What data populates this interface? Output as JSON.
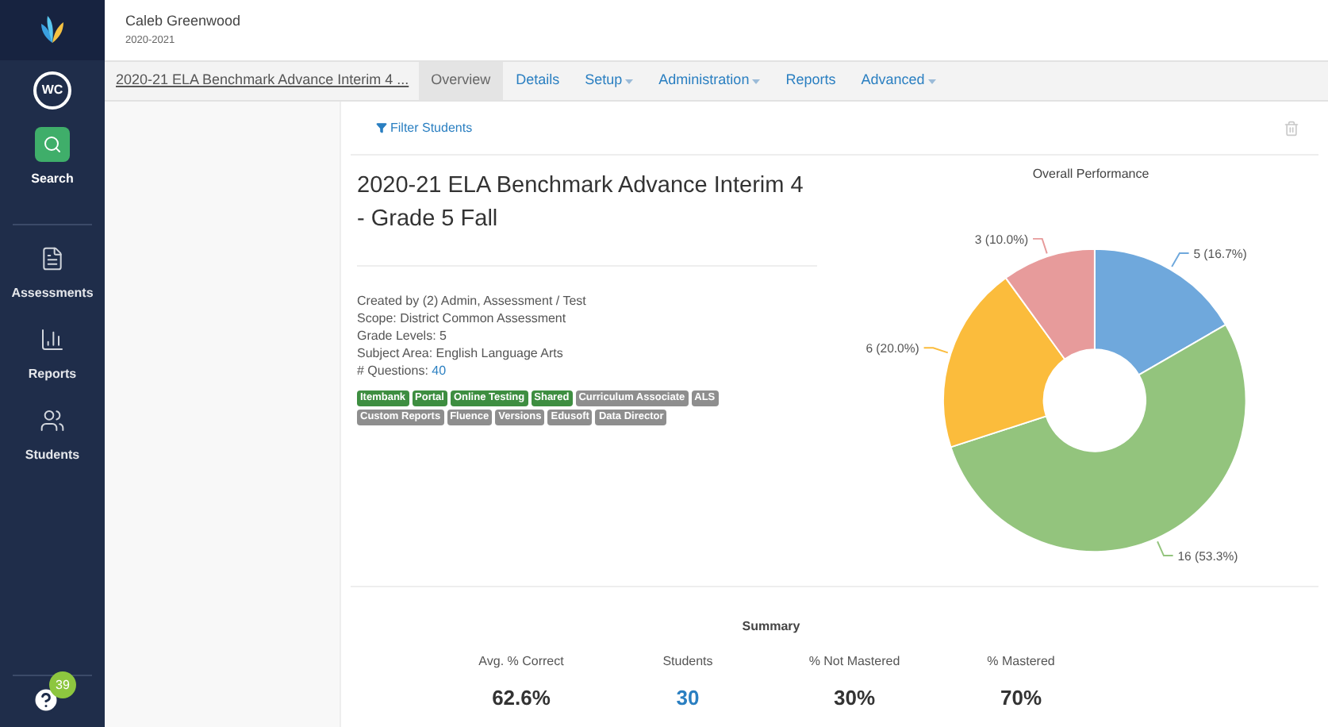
{
  "header": {
    "user_name": "Caleb Greenwood",
    "school_year": "2020-2021"
  },
  "sidebar": {
    "avatar": "WC",
    "items": [
      {
        "kind": "search",
        "label": "Search",
        "selected": true
      },
      {
        "kind": "assessments",
        "label": "Assessments",
        "selected": false
      },
      {
        "kind": "reports",
        "label": "Reports",
        "selected": false
      },
      {
        "kind": "students",
        "label": "Students",
        "selected": false
      }
    ],
    "help_badge": "39"
  },
  "tabs": [
    {
      "kind": "title",
      "label": "2020-21 ELA Benchmark Advance Interim 4 ...",
      "selected": false,
      "has_menu": false
    },
    {
      "kind": "tab",
      "label": "Overview",
      "selected": true,
      "has_menu": false
    },
    {
      "kind": "tab",
      "label": "Details",
      "selected": false,
      "has_menu": false
    },
    {
      "kind": "tab",
      "label": "Setup",
      "selected": false,
      "has_menu": true
    },
    {
      "kind": "tab",
      "label": "Administration",
      "selected": false,
      "has_menu": true
    },
    {
      "kind": "tab",
      "label": "Reports",
      "selected": false,
      "has_menu": false
    },
    {
      "kind": "tab",
      "label": "Advanced",
      "selected": false,
      "has_menu": true
    }
  ],
  "filter_link": "Filter Students",
  "assessment": {
    "title": "2020-21 ELA Benchmark Advance Interim 4 - Grade 5 Fall",
    "details": [
      "Created by (2) Admin, Assessment / Test",
      "Scope: District Common Assessment",
      "Grade Levels: 5",
      "Subject Area: English Language Arts"
    ],
    "questions_label": "# Questions:",
    "questions_count": "40",
    "tags": [
      {
        "label": "Itembank",
        "color": "#3e8e41"
      },
      {
        "label": "Portal",
        "color": "#3e8e41"
      },
      {
        "label": "Online Testing",
        "color": "#3e8e41"
      },
      {
        "label": "Shared",
        "color": "#3e8e41"
      },
      {
        "label": "Curriculum Associate",
        "color": "#8e8e8e"
      },
      {
        "label": "ALS",
        "color": "#8e8e8e"
      },
      {
        "label": "Custom Reports",
        "color": "#8e8e8e"
      },
      {
        "label": "Fluence",
        "color": "#8e8e8e"
      },
      {
        "label": "Versions",
        "color": "#8e8e8e"
      },
      {
        "label": "Edusoft",
        "color": "#8e8e8e"
      },
      {
        "label": "Data Director",
        "color": "#8e8e8e"
      }
    ]
  },
  "chart_data": {
    "type": "donut",
    "title": "Overall Performance",
    "values": [
      5,
      16,
      6,
      3
    ],
    "colors": [
      "#6fa8dc",
      "#93c47d",
      "#fbbc3c",
      "#e79b9b"
    ],
    "value_labels": [
      "5 (16.7%)",
      "16 (53.3%)",
      "6 (20.0%)",
      "3 (10.0%)"
    ]
  },
  "summary": {
    "title": "Summary",
    "stats": [
      {
        "label": "Avg. % Correct",
        "value": "62.6%",
        "kind": "plain"
      },
      {
        "label": "Students",
        "value": "30",
        "kind": "link"
      },
      {
        "label": "% Not Mastered",
        "value": "30%",
        "kind": "plain"
      },
      {
        "label": "% Mastered",
        "value": "70%",
        "kind": "plain"
      }
    ]
  }
}
